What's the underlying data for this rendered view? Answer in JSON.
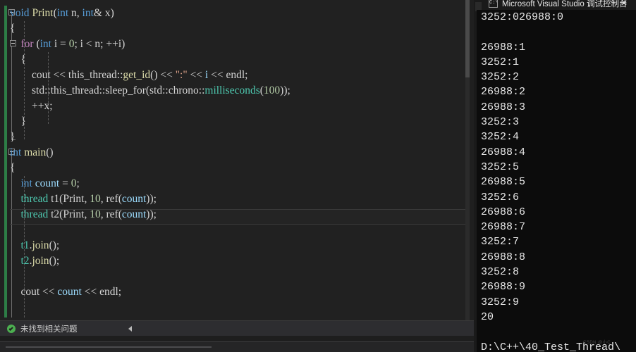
{
  "editor": {
    "name": "visual-studio-code-editor",
    "background": "#212121",
    "lines": [
      {
        "indent": 0,
        "tokens": [
          {
            "t": "void",
            "c": "kw"
          },
          {
            "t": " ",
            "c": "pl"
          },
          {
            "t": "Print",
            "c": "fn"
          },
          {
            "t": "(",
            "c": "pl"
          },
          {
            "t": "int",
            "c": "kw"
          },
          {
            "t": " n, ",
            "c": "pl"
          },
          {
            "t": "int",
            "c": "kw"
          },
          {
            "t": "& x)",
            "c": "pl"
          }
        ]
      },
      {
        "indent": 0,
        "tokens": [
          {
            "t": "{",
            "c": "pl"
          }
        ]
      },
      {
        "indent": 0,
        "tokens": [
          {
            "t": "    ",
            "c": "pl"
          },
          {
            "t": "for",
            "c": "ctl"
          },
          {
            "t": " (",
            "c": "pl"
          },
          {
            "t": "int",
            "c": "kw"
          },
          {
            "t": " i = ",
            "c": "pl"
          },
          {
            "t": "0",
            "c": "num"
          },
          {
            "t": "; i < n; ++i)",
            "c": "pl"
          }
        ]
      },
      {
        "indent": 0,
        "tokens": [
          {
            "t": "    {",
            "c": "pl"
          }
        ]
      },
      {
        "indent": 0,
        "tokens": [
          {
            "t": "        ",
            "c": "pl"
          },
          {
            "t": "cout",
            "c": "pl"
          },
          {
            "t": " << this_thread::",
            "c": "pl"
          },
          {
            "t": "get_id",
            "c": "fn"
          },
          {
            "t": "() << ",
            "c": "pl"
          },
          {
            "t": "\":\"",
            "c": "str"
          },
          {
            "t": " << ",
            "c": "pl"
          },
          {
            "t": "i",
            "c": "var"
          },
          {
            "t": " << endl;",
            "c": "pl"
          }
        ]
      },
      {
        "indent": 0,
        "tokens": [
          {
            "t": "        std::this_thread::",
            "c": "pl"
          },
          {
            "t": "sleep_for",
            "c": "pl"
          },
          {
            "t": "(std::chrono::",
            "c": "pl"
          },
          {
            "t": "milliseconds",
            "c": "typ"
          },
          {
            "t": "(",
            "c": "pl"
          },
          {
            "t": "100",
            "c": "num"
          },
          {
            "t": "));",
            "c": "pl"
          }
        ]
      },
      {
        "indent": 0,
        "tokens": [
          {
            "t": "        ++x;",
            "c": "pl"
          }
        ]
      },
      {
        "indent": 0,
        "tokens": [
          {
            "t": "    }",
            "c": "pl"
          }
        ]
      },
      {
        "indent": 0,
        "tokens": [
          {
            "t": "}",
            "c": "pl"
          }
        ]
      },
      {
        "indent": 0,
        "tokens": [
          {
            "t": "int",
            "c": "kw"
          },
          {
            "t": " ",
            "c": "pl"
          },
          {
            "t": "main",
            "c": "fn"
          },
          {
            "t": "()",
            "c": "pl"
          }
        ]
      },
      {
        "indent": 0,
        "tokens": [
          {
            "t": "{",
            "c": "pl"
          }
        ]
      },
      {
        "indent": 0,
        "tokens": [
          {
            "t": "    ",
            "c": "pl"
          },
          {
            "t": "int",
            "c": "kw"
          },
          {
            "t": " ",
            "c": "pl"
          },
          {
            "t": "count",
            "c": "var"
          },
          {
            "t": " = ",
            "c": "pl"
          },
          {
            "t": "0",
            "c": "num"
          },
          {
            "t": ";",
            "c": "pl"
          }
        ]
      },
      {
        "indent": 0,
        "tokens": [
          {
            "t": "    ",
            "c": "pl"
          },
          {
            "t": "thread",
            "c": "typ"
          },
          {
            "t": " t1(Print, ",
            "c": "pl"
          },
          {
            "t": "10",
            "c": "num"
          },
          {
            "t": ", ",
            "c": "pl"
          },
          {
            "t": "ref",
            "c": "pl"
          },
          {
            "t": "(",
            "c": "pl"
          },
          {
            "t": "count",
            "c": "var"
          },
          {
            "t": "));",
            "c": "pl"
          }
        ]
      },
      {
        "indent": 0,
        "tokens": [
          {
            "t": "    ",
            "c": "pl"
          },
          {
            "t": "thread",
            "c": "typ"
          },
          {
            "t": " t2(Print, ",
            "c": "pl"
          },
          {
            "t": "10",
            "c": "num"
          },
          {
            "t": ", ",
            "c": "pl"
          },
          {
            "t": "ref",
            "c": "pl"
          },
          {
            "t": "(",
            "c": "pl"
          },
          {
            "t": "count",
            "c": "var"
          },
          {
            "t": "));",
            "c": "pl"
          }
        ]
      },
      {
        "indent": 0,
        "tokens": [
          {
            "t": "",
            "c": "pl"
          }
        ]
      },
      {
        "indent": 0,
        "tokens": [
          {
            "t": "    ",
            "c": "pl"
          },
          {
            "t": "t1",
            "c": "typ"
          },
          {
            "t": ".",
            "c": "pl"
          },
          {
            "t": "join",
            "c": "fn"
          },
          {
            "t": "();",
            "c": "pl"
          }
        ]
      },
      {
        "indent": 0,
        "tokens": [
          {
            "t": "    ",
            "c": "pl"
          },
          {
            "t": "t2",
            "c": "typ"
          },
          {
            "t": ".",
            "c": "pl"
          },
          {
            "t": "join",
            "c": "fn"
          },
          {
            "t": "();",
            "c": "pl"
          }
        ]
      },
      {
        "indent": 0,
        "tokens": [
          {
            "t": "",
            "c": "pl"
          }
        ]
      },
      {
        "indent": 0,
        "tokens": [
          {
            "t": "    cout << ",
            "c": "pl"
          },
          {
            "t": "count",
            "c": "var"
          },
          {
            "t": " << endl;",
            "c": "pl"
          }
        ]
      }
    ],
    "current_line_index": 13
  },
  "status_bar": {
    "icon": "check-circle-icon",
    "text": "未找到相关问题",
    "collapse_icon": "collapse-left-icon"
  },
  "console": {
    "title": "Microsoft Visual Studio 调试控制台",
    "icon": "console-app-icon",
    "close_label": "✕",
    "background": "#0c0c0c",
    "lines": [
      "3252:026988:0",
      "",
      "26988:1",
      "3252:1",
      "3252:2",
      "26988:2",
      "26988:3",
      "3252:3",
      "3252:4",
      "26988:4",
      "3252:5",
      "26988:5",
      "3252:6",
      "26988:6",
      "26988:7",
      "3252:7",
      "26988:8",
      "3252:8",
      "26988:9",
      "3252:9",
      "20",
      "",
      "D:\\C++\\40_Test_Thread\\"
    ],
    "watermark": "CSDN @小C"
  },
  "colors": {
    "keyword": "#569cd6",
    "control": "#c586c0",
    "function": "#dcdcaa",
    "type": "#4ec9b0",
    "variable": "#9cdcfe",
    "string": "#d69d85",
    "number": "#b5cea8",
    "plain": "#d4d4d4",
    "editor_bg": "#212121",
    "console_bg": "#0c0c0c",
    "change_bar": "#2d7d46",
    "status_ok": "#4caf50"
  }
}
